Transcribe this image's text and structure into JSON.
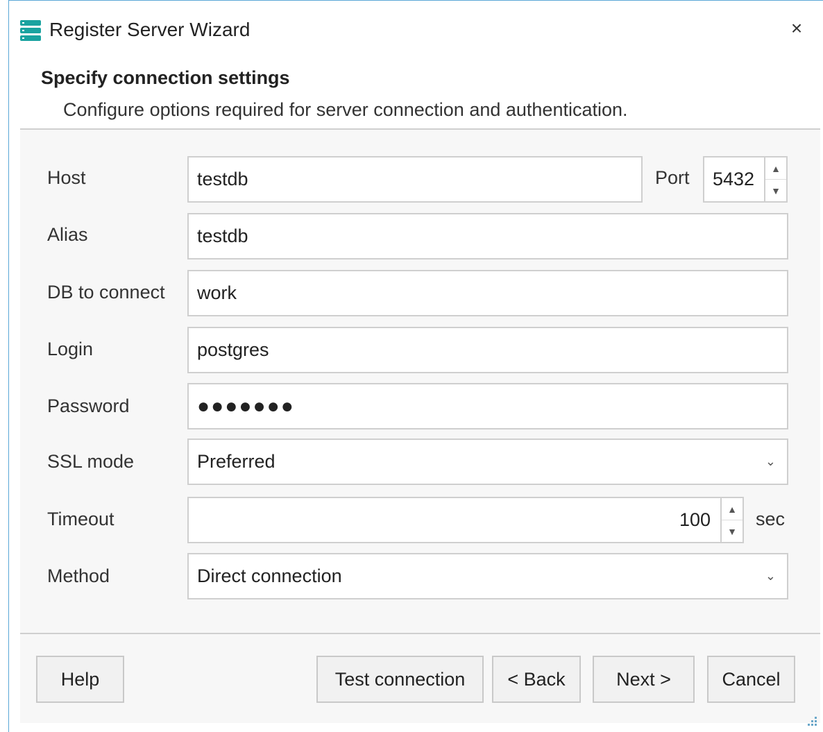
{
  "window": {
    "title": "Register Server Wizard",
    "icon": "server-stack-icon",
    "close_glyph": "×"
  },
  "header": {
    "title": "Specify connection settings",
    "subtitle": "Configure options required for server connection and authentication."
  },
  "form": {
    "host": {
      "label": "Host",
      "value": "testdb"
    },
    "port": {
      "label": "Port",
      "value": "5432"
    },
    "alias": {
      "label": "Alias",
      "value": "testdb"
    },
    "db": {
      "label": "DB to connect",
      "value": "work"
    },
    "login": {
      "label": "Login",
      "value": "postgres"
    },
    "password": {
      "label": "Password",
      "value": "●●●●●●●"
    },
    "ssl_mode": {
      "label": "SSL mode",
      "value": "Preferred"
    },
    "timeout": {
      "label": "Timeout",
      "value": "100",
      "unit": "sec"
    },
    "method": {
      "label": "Method",
      "value": "Direct connection"
    }
  },
  "buttons": {
    "help": "Help",
    "test": "Test connection",
    "back": "< Back",
    "next": "Next >",
    "cancel": "Cancel"
  },
  "colors": {
    "accent": "#5aa7d6",
    "icon_teal": "#1aa3a0",
    "panel_bg": "#f7f7f7"
  }
}
